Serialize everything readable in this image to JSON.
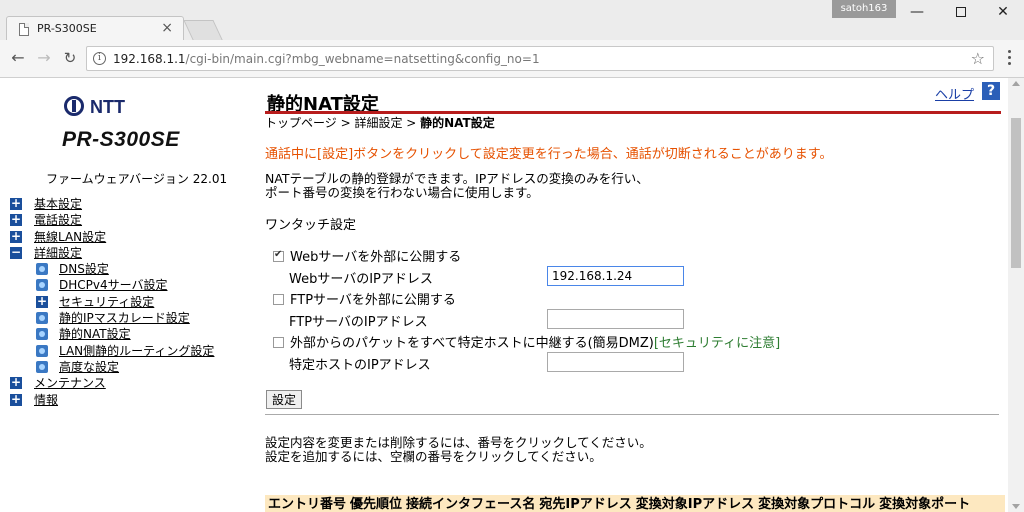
{
  "browser": {
    "tab_title": "PR-S300SE",
    "tab_close": "×",
    "user": "satoh163",
    "url_host": "192.168.1.1",
    "url_path": "/cgi-bin/main.cgi?mbg_webname=natsetting&config_no=1",
    "win_min": "—",
    "win_close": "✕"
  },
  "sidebar": {
    "brand": "NTT",
    "model": "PR-S300SE",
    "firmware": "ファームウェアバージョン 22.01",
    "items": [
      {
        "label": "基本設定",
        "level": 0,
        "icon": "plus-icon"
      },
      {
        "label": "電話設定",
        "level": 0,
        "icon": "plus-icon"
      },
      {
        "label": "無線LAN設定",
        "level": 0,
        "icon": "plus-icon"
      },
      {
        "label": "詳細設定",
        "level": 0,
        "icon": "minus-icon"
      },
      {
        "label": "DNS設定",
        "level": 1,
        "icon": "page-icon"
      },
      {
        "label": "DHCPv4サーバ設定",
        "level": 1,
        "icon": "page-icon"
      },
      {
        "label": "セキュリティ設定",
        "level": 1,
        "icon": "plus-icon"
      },
      {
        "label": "静的IPマスカレード設定",
        "level": 1,
        "icon": "page-icon"
      },
      {
        "label": "静的NAT設定",
        "level": 1,
        "icon": "page-icon"
      },
      {
        "label": "LAN側静的ルーティング設定",
        "level": 1,
        "icon": "page-icon"
      },
      {
        "label": "高度な設定",
        "level": 1,
        "icon": "page-icon"
      },
      {
        "label": "メンテナンス",
        "level": 0,
        "icon": "plus-icon"
      },
      {
        "label": "情報",
        "level": 0,
        "icon": "plus-icon"
      }
    ]
  },
  "main": {
    "title": "静的NAT設定",
    "help_label": "ヘルプ",
    "help_icon": "?",
    "breadcrumb_prefix": "トップページ > 詳細設定 > ",
    "breadcrumb_current": "静的NAT設定",
    "warning": "通話中に[設定]ボタンをクリックして設定変更を行った場合、通話が切断されることがあります。",
    "desc_line1": "NATテーブルの静的登録ができます。IPアドレスの変換のみを行い、",
    "desc_line2": "ポート番号の変換を行わない場合に使用します。",
    "one_touch_label": "ワンタッチ設定",
    "web_publish_label": "Webサーバを外部に公開する",
    "web_publish_checked": true,
    "web_ip_label": "WebサーバのIPアドレス",
    "web_ip_value": "192.168.1.24",
    "ftp_publish_label": "FTPサーバを外部に公開する",
    "ftp_publish_checked": false,
    "ftp_ip_label": "FTPサーバのIPアドレス",
    "ftp_ip_value": "",
    "dmz_label": "外部からのパケットをすべて特定ホストに中継する(簡易DMZ)",
    "dmz_note": "[セキュリティに注意]",
    "dmz_checked": false,
    "dmz_ip_label": "特定ホストのIPアドレス",
    "dmz_ip_value": "",
    "set_button": "設定",
    "instr_line1": "設定内容を変更または削除するには、番号をクリックしてください。",
    "instr_line2": "設定を追加するには、空欄の番号をクリックしてください。",
    "table_headers": [
      "エントリ番号",
      "優先順位",
      "接続インタフェース名",
      "宛先IPアドレス",
      "変換対象IPアドレス",
      "変換対象プロトコル",
      "変換対象ポート"
    ]
  }
}
